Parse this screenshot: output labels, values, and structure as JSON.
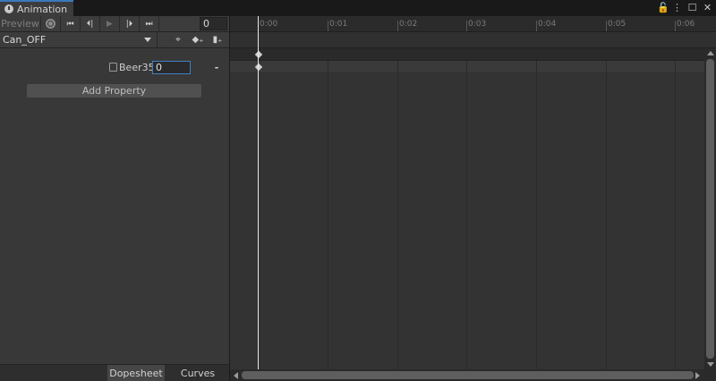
{
  "window": {
    "tab_title": "Animation",
    "controls": {
      "lock": "🔓",
      "menu": "⋮",
      "maximize": "☐",
      "close": "✕"
    }
  },
  "toolbar": {
    "preview_label": "Preview",
    "first_key": "⏮",
    "prev_key": "⏴|",
    "play": "▶",
    "next_key": "|⏵",
    "last_key": "⏭",
    "frame_value": "0"
  },
  "clip": {
    "name": "Can_OFF",
    "keyframe_tools": {
      "filter": "⌖",
      "add_keyframe": "◆₊",
      "add_event": "▮₊"
    }
  },
  "property": {
    "object": "Beer35",
    "value": "0",
    "remove": "-"
  },
  "add_property_label": "Add Property",
  "bottom_tabs": [
    {
      "label": "Dopesheet",
      "active": true
    },
    {
      "label": "Curves",
      "active": false
    }
  ],
  "timeline": {
    "ticks": [
      "0:00",
      "0:01",
      "0:02",
      "0:03",
      "0:04",
      "0:05",
      "0:06"
    ],
    "playhead_time": "0:00",
    "keyframe_time": "0:00"
  },
  "colors": {
    "accent": "#3a79bb",
    "panel": "#383838",
    "timeline": "#333333"
  }
}
